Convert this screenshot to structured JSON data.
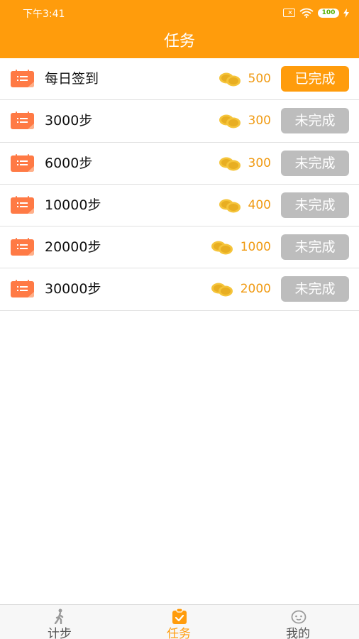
{
  "status_bar": {
    "time": "下午3:41",
    "battery": "100"
  },
  "header": {
    "title": "任务"
  },
  "tasks": [
    {
      "label": "每日签到",
      "reward": "500",
      "status": "已完成",
      "done": true
    },
    {
      "label": "3000步",
      "reward": "300",
      "status": "未完成",
      "done": false
    },
    {
      "label": "6000步",
      "reward": "300",
      "status": "未完成",
      "done": false
    },
    {
      "label": "10000步",
      "reward": "400",
      "status": "未完成",
      "done": false
    },
    {
      "label": "20000步",
      "reward": "1000",
      "status": "未完成",
      "done": false
    },
    {
      "label": "30000步",
      "reward": "2000",
      "status": "未完成",
      "done": false
    }
  ],
  "tabbar": {
    "tabs": [
      {
        "label": "计步",
        "icon": "walk-icon",
        "active": false
      },
      {
        "label": "任务",
        "icon": "task-clipboard-icon",
        "active": true
      },
      {
        "label": "我的",
        "icon": "profile-face-icon",
        "active": false
      }
    ]
  },
  "colors": {
    "accent": "#FF9C0C",
    "reward_text": "#F09A12",
    "inactive_button": "#BDBDBD",
    "tab_inactive": "#555555"
  }
}
